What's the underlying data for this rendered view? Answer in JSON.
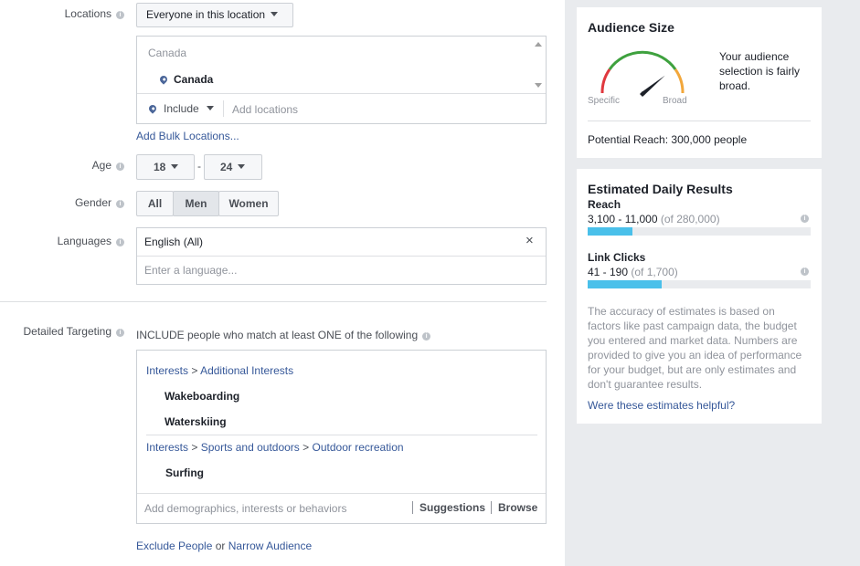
{
  "locations": {
    "label": "Locations",
    "type_select": "Everyone in this location",
    "group_header": "Canada",
    "selected": [
      "Canada"
    ],
    "include_select": "Include",
    "add_placeholder": "Add locations",
    "bulk_link": "Add Bulk Locations..."
  },
  "age": {
    "label": "Age",
    "min": "18",
    "separator": "-",
    "max": "24"
  },
  "gender": {
    "label": "Gender",
    "options": [
      "All",
      "Men",
      "Women"
    ],
    "selected": "Men"
  },
  "languages": {
    "label": "Languages",
    "selected": "English (All)",
    "remove": "×",
    "placeholder": "Enter a language..."
  },
  "detailed": {
    "label": "Detailed Targeting",
    "include_text": "INCLUDE people who match at least ONE of the following",
    "groups": [
      {
        "path": [
          "Interests",
          "Additional Interests"
        ],
        "items": [
          "Wakeboarding",
          "Waterskiing"
        ]
      },
      {
        "path": [
          "Interests",
          "Sports and outdoors",
          "Outdoor recreation"
        ],
        "items": [
          "Surfing"
        ]
      }
    ],
    "path_separator": ">",
    "add_placeholder": "Add demographics, interests or behaviors",
    "suggestions": "Suggestions",
    "browse": "Browse",
    "exclude_link": "Exclude People",
    "or_text": "or",
    "narrow_link": "Narrow Audience"
  },
  "audience": {
    "title": "Audience Size",
    "gauge_specific": "Specific",
    "gauge_broad": "Broad",
    "gauge_level": 0.78,
    "description": [
      "Your audience",
      "selection is fairly",
      "broad."
    ],
    "potential_reach": "Potential Reach: 300,000 people"
  },
  "estimates": {
    "title": "Estimated Daily Results",
    "reach": {
      "label": "Reach",
      "range": "3,100 - 11,000",
      "of": "(of 280,000)",
      "fill": 0.2
    },
    "clicks": {
      "label": "Link Clicks",
      "range": "41 - 190",
      "of": "(of 1,700)",
      "fill": 0.33
    },
    "disclaimer": [
      "The accuracy of estimates is based on",
      "factors like past campaign data, the budget",
      "you entered and market data. Numbers are",
      "provided to give you an idea of performance",
      "for your budget, but are only estimates and",
      "don't guarantee results."
    ],
    "helpful_link": "Were these estimates helpful?"
  },
  "colors": {
    "link": "#365899",
    "bar_fill": "#4ac0ea",
    "gauge_green": "#3ea13e",
    "gauge_red": "#e0383e",
    "gauge_orange": "#f2a73b",
    "panel_bg": "#e9ebee"
  },
  "icons": {
    "info": "info-icon",
    "pin": "location-pin-icon",
    "close": "close-icon"
  }
}
